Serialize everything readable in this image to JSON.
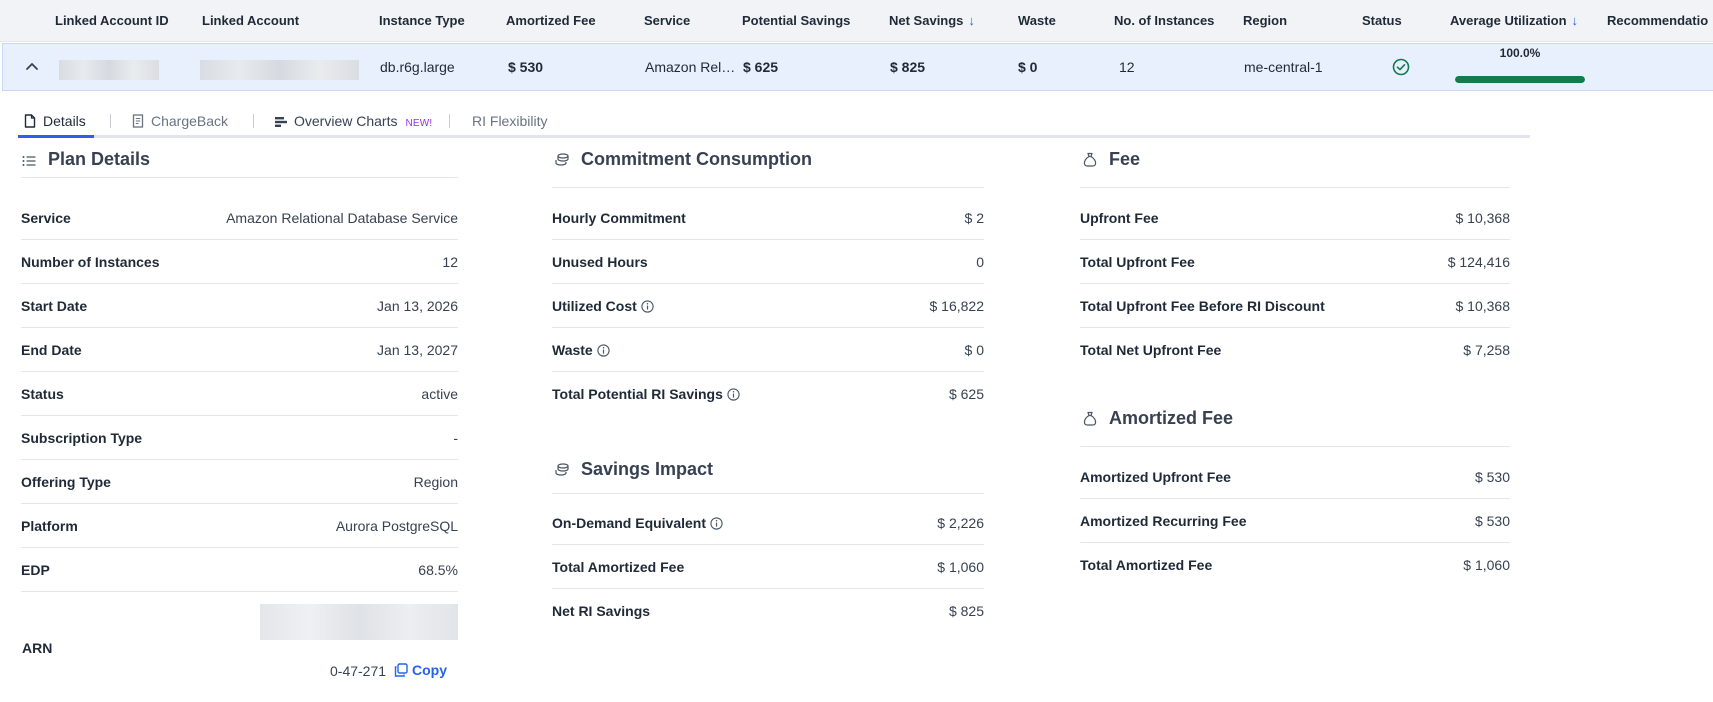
{
  "header": {
    "columns": {
      "linked_account_id": "Linked Account ID",
      "linked_account": "Linked Account",
      "instance_type": "Instance Type",
      "amortized_fee": "Amortized Fee",
      "service": "Service",
      "potential_savings": "Potential Savings",
      "net_savings": "Net Savings",
      "waste": "Waste",
      "num_instances": "No. of Instances",
      "region": "Region",
      "status": "Status",
      "average_utilization": "Average Utilization",
      "recommendation": "Recommendatio"
    },
    "sort_arrow": "↓"
  },
  "row": {
    "instance_type": "db.r6g.large",
    "amortized_fee": "$ 530",
    "service": "Amazon Rel…",
    "potential_savings": "$ 625",
    "net_savings": "$ 825",
    "waste": "$ 0",
    "num_instances": "12",
    "region": "me-central-1",
    "status_icon": "check-circle-icon",
    "status_color": "#157a4d",
    "utilization_label": "100.0%",
    "utilization_fraction": 1.0
  },
  "tabs": [
    {
      "label": "Details",
      "icon": "document-icon"
    },
    {
      "label": "ChargeBack",
      "icon": "receipt-icon"
    },
    {
      "label": "Overview Charts",
      "icon": "bars-icon",
      "badge": "NEW!"
    },
    {
      "label": "RI Flexibility"
    }
  ],
  "plan_details": {
    "title": "Plan Details",
    "rows": [
      {
        "label": "Service",
        "value": "Amazon Relational Database Service"
      },
      {
        "label": "Number of Instances",
        "value": "12"
      },
      {
        "label": "Start Date",
        "value": "Jan 13, 2026"
      },
      {
        "label": "End Date",
        "value": "Jan 13, 2027"
      },
      {
        "label": "Status",
        "value": "active"
      },
      {
        "label": "Subscription Type",
        "value": "-"
      },
      {
        "label": "Offering Type",
        "value": "Region"
      },
      {
        "label": "Platform",
        "value": "Aurora PostgreSQL"
      },
      {
        "label": "EDP",
        "value": "68.5%"
      }
    ],
    "arn_label": "ARN",
    "arn_value": "0-47-271",
    "copy_label": "Copy"
  },
  "commitment": {
    "title": "Commitment Consumption",
    "rows": [
      {
        "label": "Hourly Commitment",
        "value": "$ 2"
      },
      {
        "label": "Unused Hours",
        "value": "0"
      },
      {
        "label": "Utilized Cost",
        "value": "$ 16,822"
      },
      {
        "label": "Waste",
        "value": "$ 0"
      },
      {
        "label": "Total Potential RI Savings",
        "value": "$ 625"
      }
    ]
  },
  "savings_impact": {
    "title": "Savings Impact",
    "rows": [
      {
        "label": "On-Demand Equivalent",
        "value": "$ 2,226"
      },
      {
        "label": "Total Amortized Fee",
        "value": "$ 1,060"
      },
      {
        "label": "Net RI Savings",
        "value": "$ 825"
      }
    ]
  },
  "fee": {
    "title": "Fee",
    "rows": [
      {
        "label": "Upfront Fee",
        "value": "$ 10,368"
      },
      {
        "label": "Total Upfront Fee",
        "value": "$ 124,416"
      },
      {
        "label": "Total Upfront Fee Before RI Discount",
        "value": "$ 10,368"
      },
      {
        "label": "Total Net Upfront Fee",
        "value": "$ 7,258"
      }
    ]
  },
  "amortized_fee": {
    "title": "Amortized Fee",
    "rows": [
      {
        "label": "Amortized Upfront Fee",
        "value": "$ 530"
      },
      {
        "label": "Amortized Recurring Fee",
        "value": "$ 530"
      },
      {
        "label": "Total Amortized Fee",
        "value": "$ 1,060"
      }
    ]
  },
  "colors": {
    "accent": "#2563eb",
    "success": "#157a4d",
    "badge": "#9333ea"
  }
}
